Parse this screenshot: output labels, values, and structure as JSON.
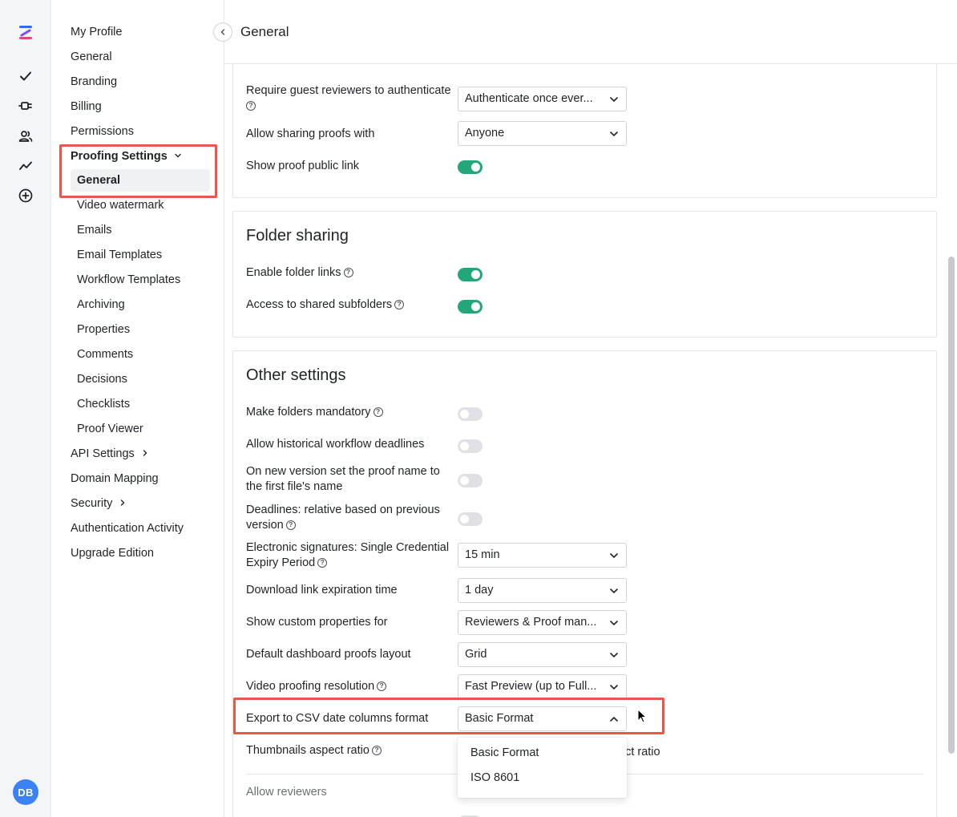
{
  "header": {
    "title": "General"
  },
  "nav": {
    "items": [
      "My Profile",
      "General",
      "Branding",
      "Billing",
      "Permissions"
    ],
    "proofing_label": "Proofing Settings",
    "proofing_sub": [
      "General",
      "Video watermark",
      "Emails",
      "Email Templates",
      "Workflow Templates",
      "Archiving",
      "Properties",
      "Comments",
      "Decisions",
      "Checklists",
      "Proof Viewer"
    ],
    "api": "API Settings",
    "domain": "Domain Mapping",
    "security": "Security",
    "auth": "Authentication Activity",
    "upgrade": "Upgrade Edition"
  },
  "avatar": "DB",
  "sharing": {
    "guest_auth_label": "Require guest reviewers to authenticate",
    "guest_auth_value": "Authenticate once ever...",
    "allow_share_label": "Allow sharing proofs with",
    "allow_share_value": "Anyone",
    "public_link_label": "Show proof public link"
  },
  "folder": {
    "title": "Folder sharing",
    "links_label": "Enable folder links",
    "subfolders_label": "Access to shared subfolders"
  },
  "other": {
    "title": "Other settings",
    "mandatory_label": "Make folders mandatory",
    "historical_label": "Allow historical workflow deadlines",
    "newversion_label_1": "On new version set the proof name to",
    "newversion_label_2": "the first file's name",
    "deadlines_label_1": "Deadlines: relative based on previous",
    "deadlines_label_2": "version",
    "esig_label_1": "Electronic signatures: Single Credential",
    "esig_label_2": "Expiry Period",
    "esig_value": "15 min",
    "download_label": "Download link expiration time",
    "download_value": "1 day",
    "custom_props_label": "Show custom properties for",
    "custom_props_value": "Reviewers & Proof man...",
    "dashboard_label": "Default dashboard proofs layout",
    "dashboard_value": "Grid",
    "video_label": "Video proofing resolution",
    "video_value": "Fast Preview (up to Full...",
    "csv_label": "Export to CSV date columns format",
    "csv_value": "Basic Format",
    "thumb_label": "Thumbnails aspect ratio",
    "thumb_value_partial": "ect ratio",
    "allow_reviewers": "Allow reviewers",
    "csv_options": [
      "Basic Format",
      "ISO 8601"
    ]
  }
}
